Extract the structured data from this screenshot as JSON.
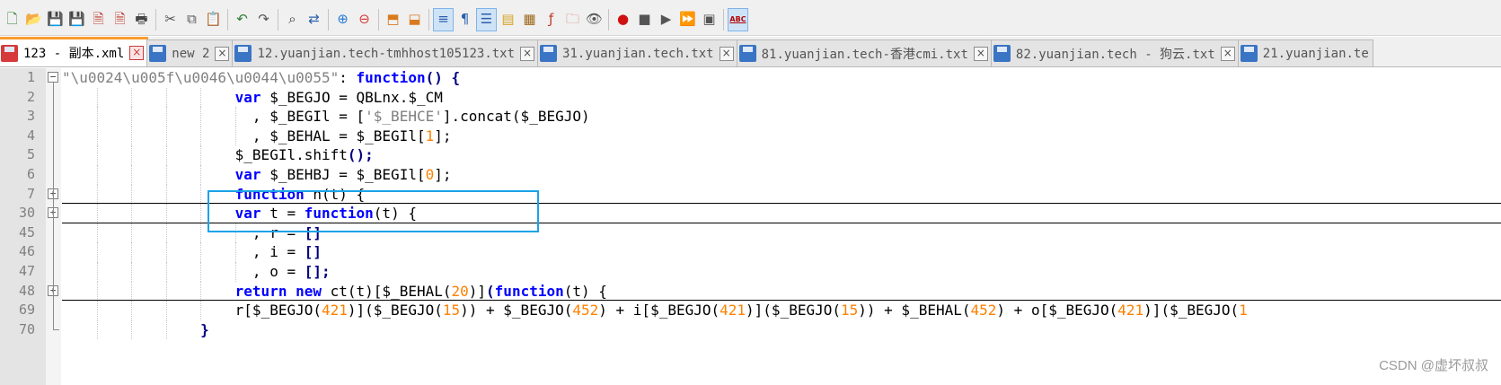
{
  "toolbar": {
    "buttons": [
      {
        "name": "new-file-icon",
        "glyph": "🗋",
        "color": "#2e7d32"
      },
      {
        "name": "open-file-icon",
        "glyph": "📂",
        "color": "#c9a227"
      },
      {
        "name": "save-icon",
        "glyph": "💾",
        "color": "#2b5fad"
      },
      {
        "name": "save-all-icon",
        "glyph": "💾",
        "color": "#2b5fad"
      },
      {
        "name": "close-icon",
        "glyph": "🗎",
        "color": "#c0392b"
      },
      {
        "name": "close-all-icon",
        "glyph": "🗎",
        "color": "#c0392b"
      },
      {
        "name": "print-icon",
        "glyph": "🖶",
        "color": "#444444"
      },
      {
        "sep": true
      },
      {
        "name": "cut-icon",
        "glyph": "✂",
        "color": "#555555"
      },
      {
        "name": "copy-icon",
        "glyph": "⧉",
        "color": "#555555"
      },
      {
        "name": "paste-icon",
        "glyph": "📋",
        "color": "#b07a2a"
      },
      {
        "sep": true
      },
      {
        "name": "undo-icon",
        "glyph": "↶",
        "color": "#2e7d32"
      },
      {
        "name": "redo-icon",
        "glyph": "↷",
        "color": "#555555"
      },
      {
        "sep": true
      },
      {
        "name": "find-icon",
        "glyph": "⌕",
        "color": "#333333"
      },
      {
        "name": "replace-icon",
        "glyph": "⇄",
        "color": "#2b5fad"
      },
      {
        "sep": true
      },
      {
        "name": "zoom-in-icon",
        "glyph": "⊕",
        "color": "#2b7bd6"
      },
      {
        "name": "zoom-out-icon",
        "glyph": "⊖",
        "color": "#d63a3a"
      },
      {
        "sep": true
      },
      {
        "name": "sync-vertical-icon",
        "glyph": "⬒",
        "color": "#d97a1e"
      },
      {
        "name": "sync-horizontal-icon",
        "glyph": "⬓",
        "color": "#d97a1e"
      },
      {
        "sep": true
      },
      {
        "name": "word-wrap-icon",
        "glyph": "≡",
        "color": "#2b5fad",
        "active": true
      },
      {
        "name": "show-all-chars-icon",
        "glyph": "¶",
        "color": "#2b5fad"
      },
      {
        "name": "indent-guide-icon",
        "glyph": "☰",
        "color": "#2b5fad",
        "active": true
      },
      {
        "name": "user-language-icon",
        "glyph": "▤",
        "color": "#d9a21e"
      },
      {
        "name": "document-map-icon",
        "glyph": "▦",
        "color": "#9c6a1e"
      },
      {
        "name": "function-list-icon",
        "glyph": "ƒ",
        "color": "#c0392b"
      },
      {
        "name": "folder-workspace-icon",
        "glyph": "🗀",
        "color": "#d96b6b"
      },
      {
        "name": "monitoring-icon",
        "glyph": "👁",
        "color": "#555555"
      },
      {
        "sep": true
      },
      {
        "name": "record-macro-icon",
        "glyph": "●",
        "color": "#d01010"
      },
      {
        "name": "stop-macro-icon",
        "glyph": "■",
        "color": "#555555"
      },
      {
        "name": "play-macro-icon",
        "glyph": "▶",
        "color": "#555555"
      },
      {
        "name": "run-macro-multiple-icon",
        "glyph": "⏩",
        "color": "#2b5fad"
      },
      {
        "name": "save-macro-icon",
        "glyph": "▣",
        "color": "#555555"
      },
      {
        "sep": true
      },
      {
        "name": "spell-check-icon",
        "glyph": "ABC",
        "color": "#b00000",
        "active": true
      }
    ]
  },
  "tabs": [
    {
      "label": "123 - 副本.xml",
      "active": true,
      "icon": "red"
    },
    {
      "label": "new 2",
      "active": false,
      "icon": "blue"
    },
    {
      "label": "12.yuanjian.tech-tmhhost105123.txt",
      "active": false,
      "icon": "blue"
    },
    {
      "label": "31.yuanjian.tech.txt",
      "active": false,
      "icon": "blue"
    },
    {
      "label": "81.yuanjian.tech-香港cmi.txt",
      "active": false,
      "icon": "blue"
    },
    {
      "label": "82.yuanjian.tech - 狗云.txt",
      "active": false,
      "icon": "blue"
    },
    {
      "label": "21.yuanjian.te",
      "active": false,
      "icon": "blue"
    }
  ],
  "editor": {
    "lines": [
      {
        "num": "1",
        "fold": "minus",
        "guides": [],
        "tokens": [
          [
            "str",
            "\"\\u0024\\u005f\\u0046\\u0044\\u0055\""
          ],
          [
            "p",
            ": "
          ],
          [
            "kw",
            "function"
          ],
          [
            "op",
            "() {"
          ]
        ]
      },
      {
        "num": "2",
        "guides": [
          1,
          2,
          3,
          4
        ],
        "tokens": [
          [
            "p",
            "                    "
          ],
          [
            "kw",
            "var"
          ],
          [
            "p",
            " $_BEGJO = QBLnx.$_CM"
          ]
        ]
      },
      {
        "num": "3",
        "guides": [
          1,
          2,
          3,
          4,
          5
        ],
        "tokens": [
          [
            "p",
            "                      , $_BEGIl = ["
          ],
          [
            "str",
            "'$_BEHCE'"
          ],
          [
            "p",
            "].concat($_BEGJO)"
          ]
        ]
      },
      {
        "num": "4",
        "guides": [
          1,
          2,
          3,
          4,
          5
        ],
        "tokens": [
          [
            "p",
            "                      , $_BEHAL = $_BEGIl["
          ],
          [
            "num",
            "1"
          ],
          [
            "p",
            "];"
          ]
        ]
      },
      {
        "num": "5",
        "guides": [
          1,
          2,
          3,
          4
        ],
        "tokens": [
          [
            "p",
            "                    $_BEGIl.shift"
          ],
          [
            "op",
            "();"
          ]
        ]
      },
      {
        "num": "6",
        "guides": [
          1,
          2,
          3,
          4
        ],
        "tokens": [
          [
            "p",
            "                    "
          ],
          [
            "kw",
            "var"
          ],
          [
            "p",
            " $_BEHBJ = $_BEGIl["
          ],
          [
            "num",
            "0"
          ],
          [
            "p",
            "];"
          ]
        ]
      },
      {
        "num": "7",
        "fold": "plus",
        "sep": true,
        "guides": [
          1,
          2,
          3,
          4
        ],
        "tokens": [
          [
            "p",
            "                    "
          ],
          [
            "kw",
            "function"
          ],
          [
            "p",
            " n(t) {"
          ]
        ]
      },
      {
        "num": "30",
        "fold": "plus",
        "sep": true,
        "guides": [
          1,
          2,
          3,
          4
        ],
        "tokens": [
          [
            "p",
            "                    "
          ],
          [
            "kw",
            "var"
          ],
          [
            "p",
            " t = "
          ],
          [
            "kw",
            "function"
          ],
          [
            "p",
            "(t) {"
          ]
        ]
      },
      {
        "num": "45",
        "guides": [
          1,
          2,
          3,
          4,
          5
        ],
        "tokens": [
          [
            "p",
            "                      , r = "
          ],
          [
            "op",
            "[]"
          ]
        ]
      },
      {
        "num": "46",
        "guides": [
          1,
          2,
          3,
          4,
          5
        ],
        "tokens": [
          [
            "p",
            "                      , i = "
          ],
          [
            "op",
            "[]"
          ]
        ]
      },
      {
        "num": "47",
        "guides": [
          1,
          2,
          3,
          4,
          5
        ],
        "tokens": [
          [
            "p",
            "                      , o = "
          ],
          [
            "op",
            "[];"
          ]
        ]
      },
      {
        "num": "48",
        "fold": "plus",
        "sep": true,
        "guides": [
          1,
          2,
          3,
          4
        ],
        "tokens": [
          [
            "p",
            "                    "
          ],
          [
            "kw",
            "return"
          ],
          [
            "p",
            " "
          ],
          [
            "kw",
            "new"
          ],
          [
            "p",
            " ct(t)[$_BEHAL("
          ],
          [
            "num",
            "20"
          ],
          [
            "p",
            ")]"
          ],
          [
            "op",
            "("
          ],
          [
            "kw",
            "function"
          ],
          [
            "p",
            "(t) {"
          ]
        ]
      },
      {
        "num": "69",
        "guides": [
          1,
          2,
          3,
          4
        ],
        "tokens": [
          [
            "p",
            "                    r[$_BEGJO("
          ],
          [
            "num",
            "421"
          ],
          [
            "p",
            ")]($_BEGJO("
          ],
          [
            "num",
            "15"
          ],
          [
            "p",
            ")) + $_BEGJO("
          ],
          [
            "num",
            "452"
          ],
          [
            "p",
            ") + i[$_BEGJO("
          ],
          [
            "num",
            "421"
          ],
          [
            "p",
            ")]($_BEGJO("
          ],
          [
            "num",
            "15"
          ],
          [
            "p",
            ")) + $_BEHAL("
          ],
          [
            "num",
            "452"
          ],
          [
            "p",
            ") + o[$_BEGJO("
          ],
          [
            "num",
            "421"
          ],
          [
            "p",
            ")]($_BEGJO("
          ],
          [
            "num",
            "1"
          ]
        ]
      },
      {
        "num": "70",
        "fold": "end",
        "guides": [
          1,
          2,
          3
        ],
        "tokens": [
          [
            "p",
            "                "
          ],
          [
            "op",
            "}"
          ]
        ]
      }
    ]
  },
  "watermark": "CSDN @虚坏叔叔"
}
